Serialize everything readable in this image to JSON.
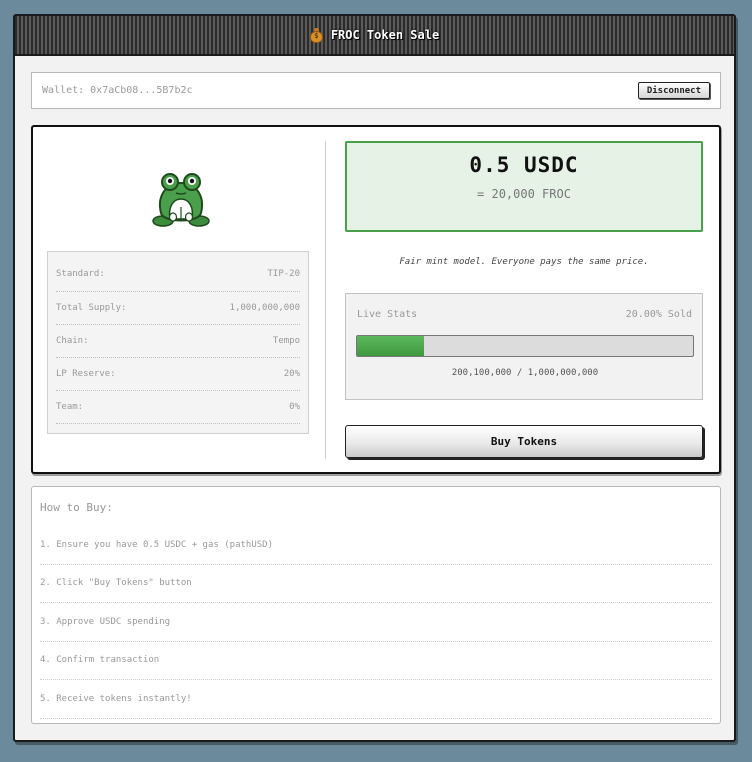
{
  "window": {
    "title_icon": "money-bag-icon",
    "title": "FROC Token Sale"
  },
  "wallet": {
    "label": "Wallet: 0x7aCb08...5B7b2c",
    "disconnect_label": "Disconnect"
  },
  "token_info": {
    "logo": "frog-mascot-icon",
    "rows": [
      {
        "key": "Standard:",
        "value": "TIP-20"
      },
      {
        "key": "Total Supply:",
        "value": "1,000,000,000"
      },
      {
        "key": "Chain:",
        "value": "Tempo"
      },
      {
        "key": "LP Reserve:",
        "value": "20%"
      },
      {
        "key": "Team:",
        "value": "0%"
      }
    ]
  },
  "price": {
    "main": "0.5 USDC",
    "sub": "= 20,000 FROC"
  },
  "fair_note": "Fair mint model. Everyone pays the same price.",
  "stats": {
    "title": "Live Stats",
    "sold_label": "20.00% Sold",
    "progress_fraction": 0.2001,
    "count": "200,100,000 / 1,000,000,000",
    "accent_color": "#4cae4c"
  },
  "buy_label": "Buy Tokens",
  "howto": {
    "title": "How to Buy:",
    "steps": [
      "1. Ensure you have 0.5 USDC + gas (pathUSD)",
      "2. Click \"Buy Tokens\" button",
      "3. Approve USDC spending",
      "4. Confirm transaction",
      "5. Receive tokens instantly!"
    ]
  }
}
